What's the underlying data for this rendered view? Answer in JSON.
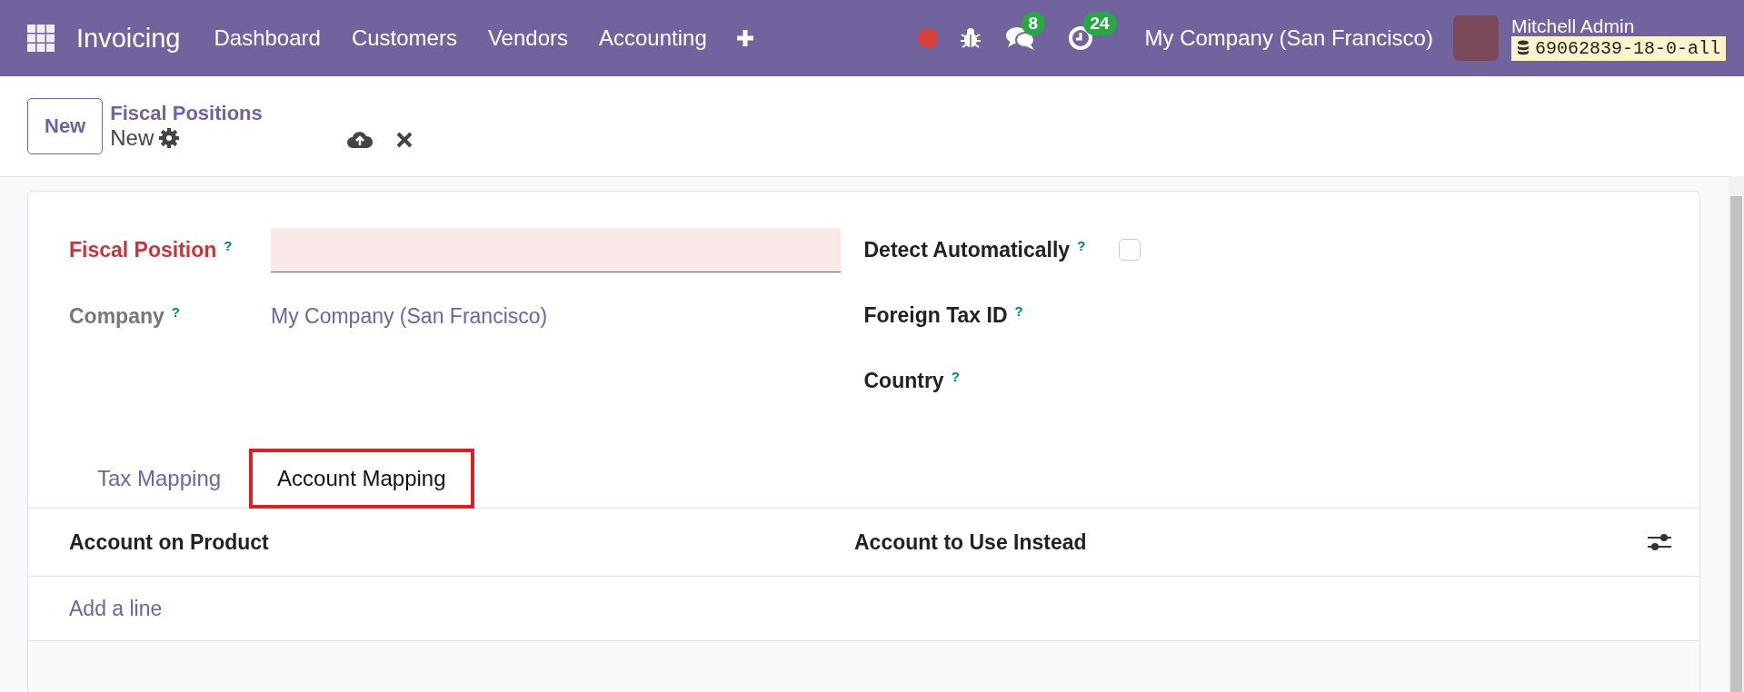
{
  "navbar": {
    "app_name": "Invoicing",
    "menu": [
      "Dashboard",
      "Customers",
      "Vendors",
      "Accounting"
    ],
    "messages_count": "8",
    "activities_count": "24",
    "company": "My Company (San Francisco)",
    "user_name": "Mitchell Admin",
    "database": "69062839-18-0-all"
  },
  "control_panel": {
    "new_button": "New",
    "breadcrumb": "Fiscal Positions",
    "record_name": "New"
  },
  "form": {
    "left_fields": [
      {
        "label": "Fiscal Position",
        "help": "?",
        "required": true,
        "kind": "input"
      },
      {
        "label": "Company",
        "help": "?",
        "required": false,
        "kind": "value",
        "value": "My Company (San Francisco)"
      }
    ],
    "right_fields": [
      {
        "label": "Detect Automatically",
        "help": "?",
        "kind": "checkbox",
        "checked": false
      },
      {
        "label": "Foreign Tax ID",
        "help": "?",
        "kind": "empty"
      },
      {
        "label": "Country",
        "help": "?",
        "kind": "empty"
      }
    ],
    "tabs": [
      {
        "label": "Tax Mapping",
        "selected": false,
        "highlighted": false
      },
      {
        "label": "Account Mapping",
        "selected": true,
        "highlighted": true
      }
    ],
    "table": {
      "columns": [
        "Account on Product",
        "Account to Use Instead"
      ],
      "add_line": "Add a line"
    }
  }
}
